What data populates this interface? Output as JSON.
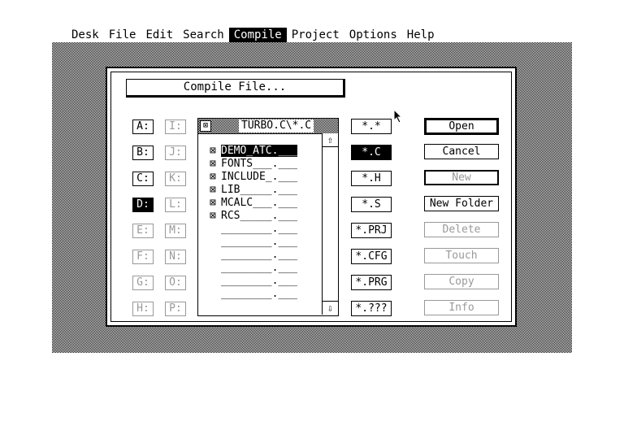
{
  "menubar": [
    "Desk",
    "File",
    "Edit",
    "Search",
    "Compile",
    "Project",
    "Options",
    "Help"
  ],
  "active_menu": "Compile",
  "dialog": {
    "title": "Compile File...",
    "path": "TURBO.C\\*.C",
    "drives": [
      {
        "label": "A:",
        "state": "enabled"
      },
      {
        "label": "B:",
        "state": "enabled"
      },
      {
        "label": "C:",
        "state": "enabled"
      },
      {
        "label": "D:",
        "state": "selected"
      },
      {
        "label": "E:",
        "state": "disabled"
      },
      {
        "label": "F:",
        "state": "disabled"
      },
      {
        "label": "G:",
        "state": "disabled"
      },
      {
        "label": "H:",
        "state": "disabled"
      },
      {
        "label": "I:",
        "state": "disabled"
      },
      {
        "label": "J:",
        "state": "disabled"
      },
      {
        "label": "K:",
        "state": "disabled"
      },
      {
        "label": "L:",
        "state": "disabled"
      },
      {
        "label": "M:",
        "state": "disabled"
      },
      {
        "label": "N:",
        "state": "disabled"
      },
      {
        "label": "O:",
        "state": "disabled"
      },
      {
        "label": "P:",
        "state": "disabled"
      }
    ],
    "files": [
      {
        "name": "DEMO_ATC.___",
        "folder": true,
        "selected": true
      },
      {
        "name": "FONTS___.___",
        "folder": true,
        "selected": false
      },
      {
        "name": "INCLUDE_.___",
        "folder": true,
        "selected": false
      },
      {
        "name": "LIB_____.___",
        "folder": true,
        "selected": false
      },
      {
        "name": "MCALC___.___",
        "folder": true,
        "selected": false
      },
      {
        "name": "RCS_____.___",
        "folder": true,
        "selected": false
      },
      {
        "name": "________.___",
        "folder": false,
        "selected": false
      },
      {
        "name": "________.___",
        "folder": false,
        "selected": false
      },
      {
        "name": "________.___",
        "folder": false,
        "selected": false
      },
      {
        "name": "________.___",
        "folder": false,
        "selected": false
      },
      {
        "name": "________.___",
        "folder": false,
        "selected": false
      },
      {
        "name": "________.___",
        "folder": false,
        "selected": false
      }
    ],
    "filters": [
      {
        "label": "*.*",
        "selected": false
      },
      {
        "label": "*.C",
        "selected": true
      },
      {
        "label": "*.H",
        "selected": false
      },
      {
        "label": "*.S",
        "selected": false
      },
      {
        "label": "*.PRJ",
        "selected": false
      },
      {
        "label": "*.CFG",
        "selected": false
      },
      {
        "label": "*.PRG",
        "selected": false
      },
      {
        "label": "*.???",
        "selected": false
      }
    ],
    "actions": [
      {
        "label": "Open",
        "state": "default"
      },
      {
        "label": "Cancel",
        "state": "enabled"
      },
      {
        "label": "New",
        "state": "new"
      },
      {
        "label": "New Folder",
        "state": "enabled"
      },
      {
        "label": "Delete",
        "state": "disabled"
      },
      {
        "label": "Touch",
        "state": "disabled"
      },
      {
        "label": "Copy",
        "state": "disabled"
      },
      {
        "label": "Info",
        "state": "disabled"
      }
    ],
    "icons": {
      "folder": "folder-icon",
      "close": "close-box-icon",
      "scroll_up": "arrow-up-icon",
      "scroll_down": "arrow-down-icon",
      "cursor": "mouse-pointer-icon"
    }
  }
}
